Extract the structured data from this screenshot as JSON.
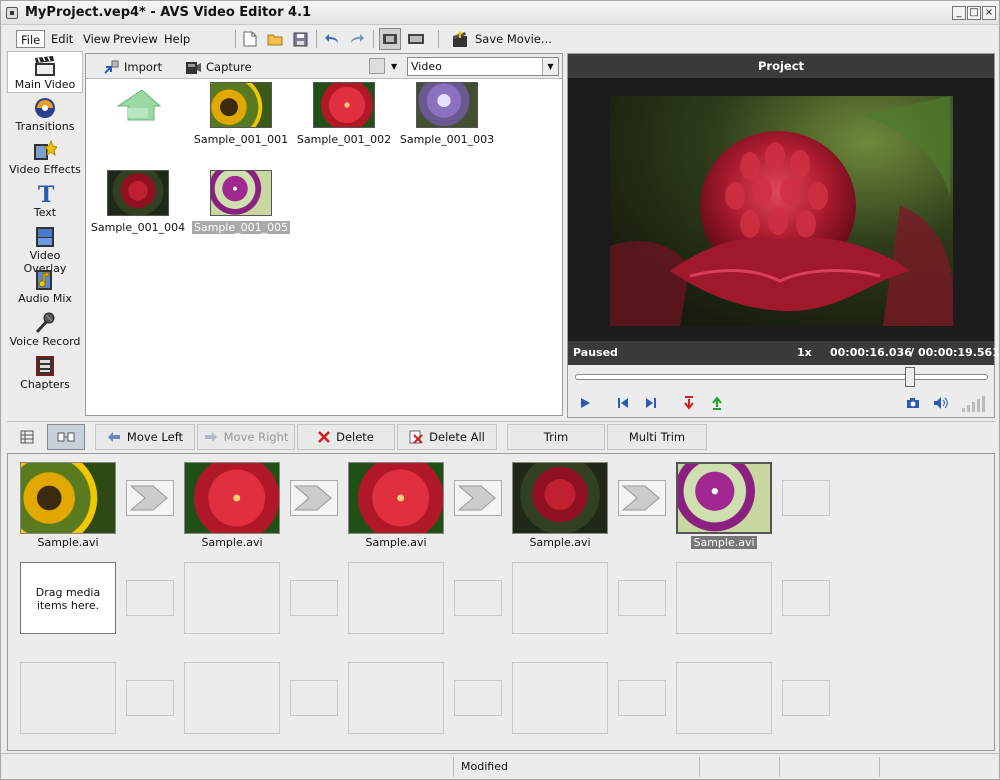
{
  "window": {
    "title": "MyProject.vep4* - AVS Video Editor 4.1"
  },
  "menu": {
    "file": "File",
    "edit": "Edit",
    "view": "View",
    "preview": "Preview",
    "help": "Help"
  },
  "toolbar": {
    "save_movie": "Save Movie..."
  },
  "sidebar": {
    "items": [
      {
        "label": "Main Video",
        "icon": "film-clapper-icon"
      },
      {
        "label": "Transitions",
        "icon": "transitions-icon"
      },
      {
        "label": "Video Effects",
        "icon": "video-effects-icon"
      },
      {
        "label": "Text",
        "icon": "text-icon"
      },
      {
        "label": "Video Overlay",
        "icon": "video-overlay-icon"
      },
      {
        "label": "Audio Mix",
        "icon": "audio-mix-icon"
      },
      {
        "label": "Voice Record",
        "icon": "microphone-icon"
      },
      {
        "label": "Chapters",
        "icon": "chapters-icon"
      }
    ]
  },
  "browser": {
    "import": "Import",
    "capture": "Capture",
    "filter": "Video",
    "files": [
      "Sample_001_001",
      "Sample_001_002",
      "Sample_001_003",
      "Sample_001_004",
      "Sample_001_005"
    ]
  },
  "preview": {
    "header": "Project",
    "state": "Paused",
    "speed": "1x",
    "current": "00:00:16.036",
    "sep": "/",
    "total": "00:00:19.561",
    "progress_fraction": 0.82
  },
  "timeline_toolbar": {
    "move_left": "Move Left",
    "move_right": "Move Right",
    "delete": "Delete",
    "delete_all": "Delete All",
    "trim": "Trim",
    "multi_trim": "Multi Trim"
  },
  "storyboard": {
    "clips": [
      "Sample.avi",
      "Sample.avi",
      "Sample.avi",
      "Sample.avi",
      "Sample.avi"
    ],
    "drag_hint": "Drag media items here."
  },
  "status": {
    "text": "Modified"
  }
}
